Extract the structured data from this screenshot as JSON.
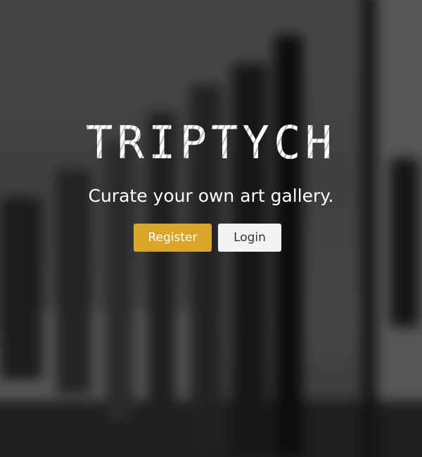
{
  "hero": {
    "logo_text": "TRIPTYCH",
    "tagline": "Curate your own art gallery.",
    "register_label": "Register",
    "login_label": "Login"
  },
  "colors": {
    "register_button": "#d9a52a",
    "login_button": "#f3f3f3",
    "text": "#ffffff"
  }
}
